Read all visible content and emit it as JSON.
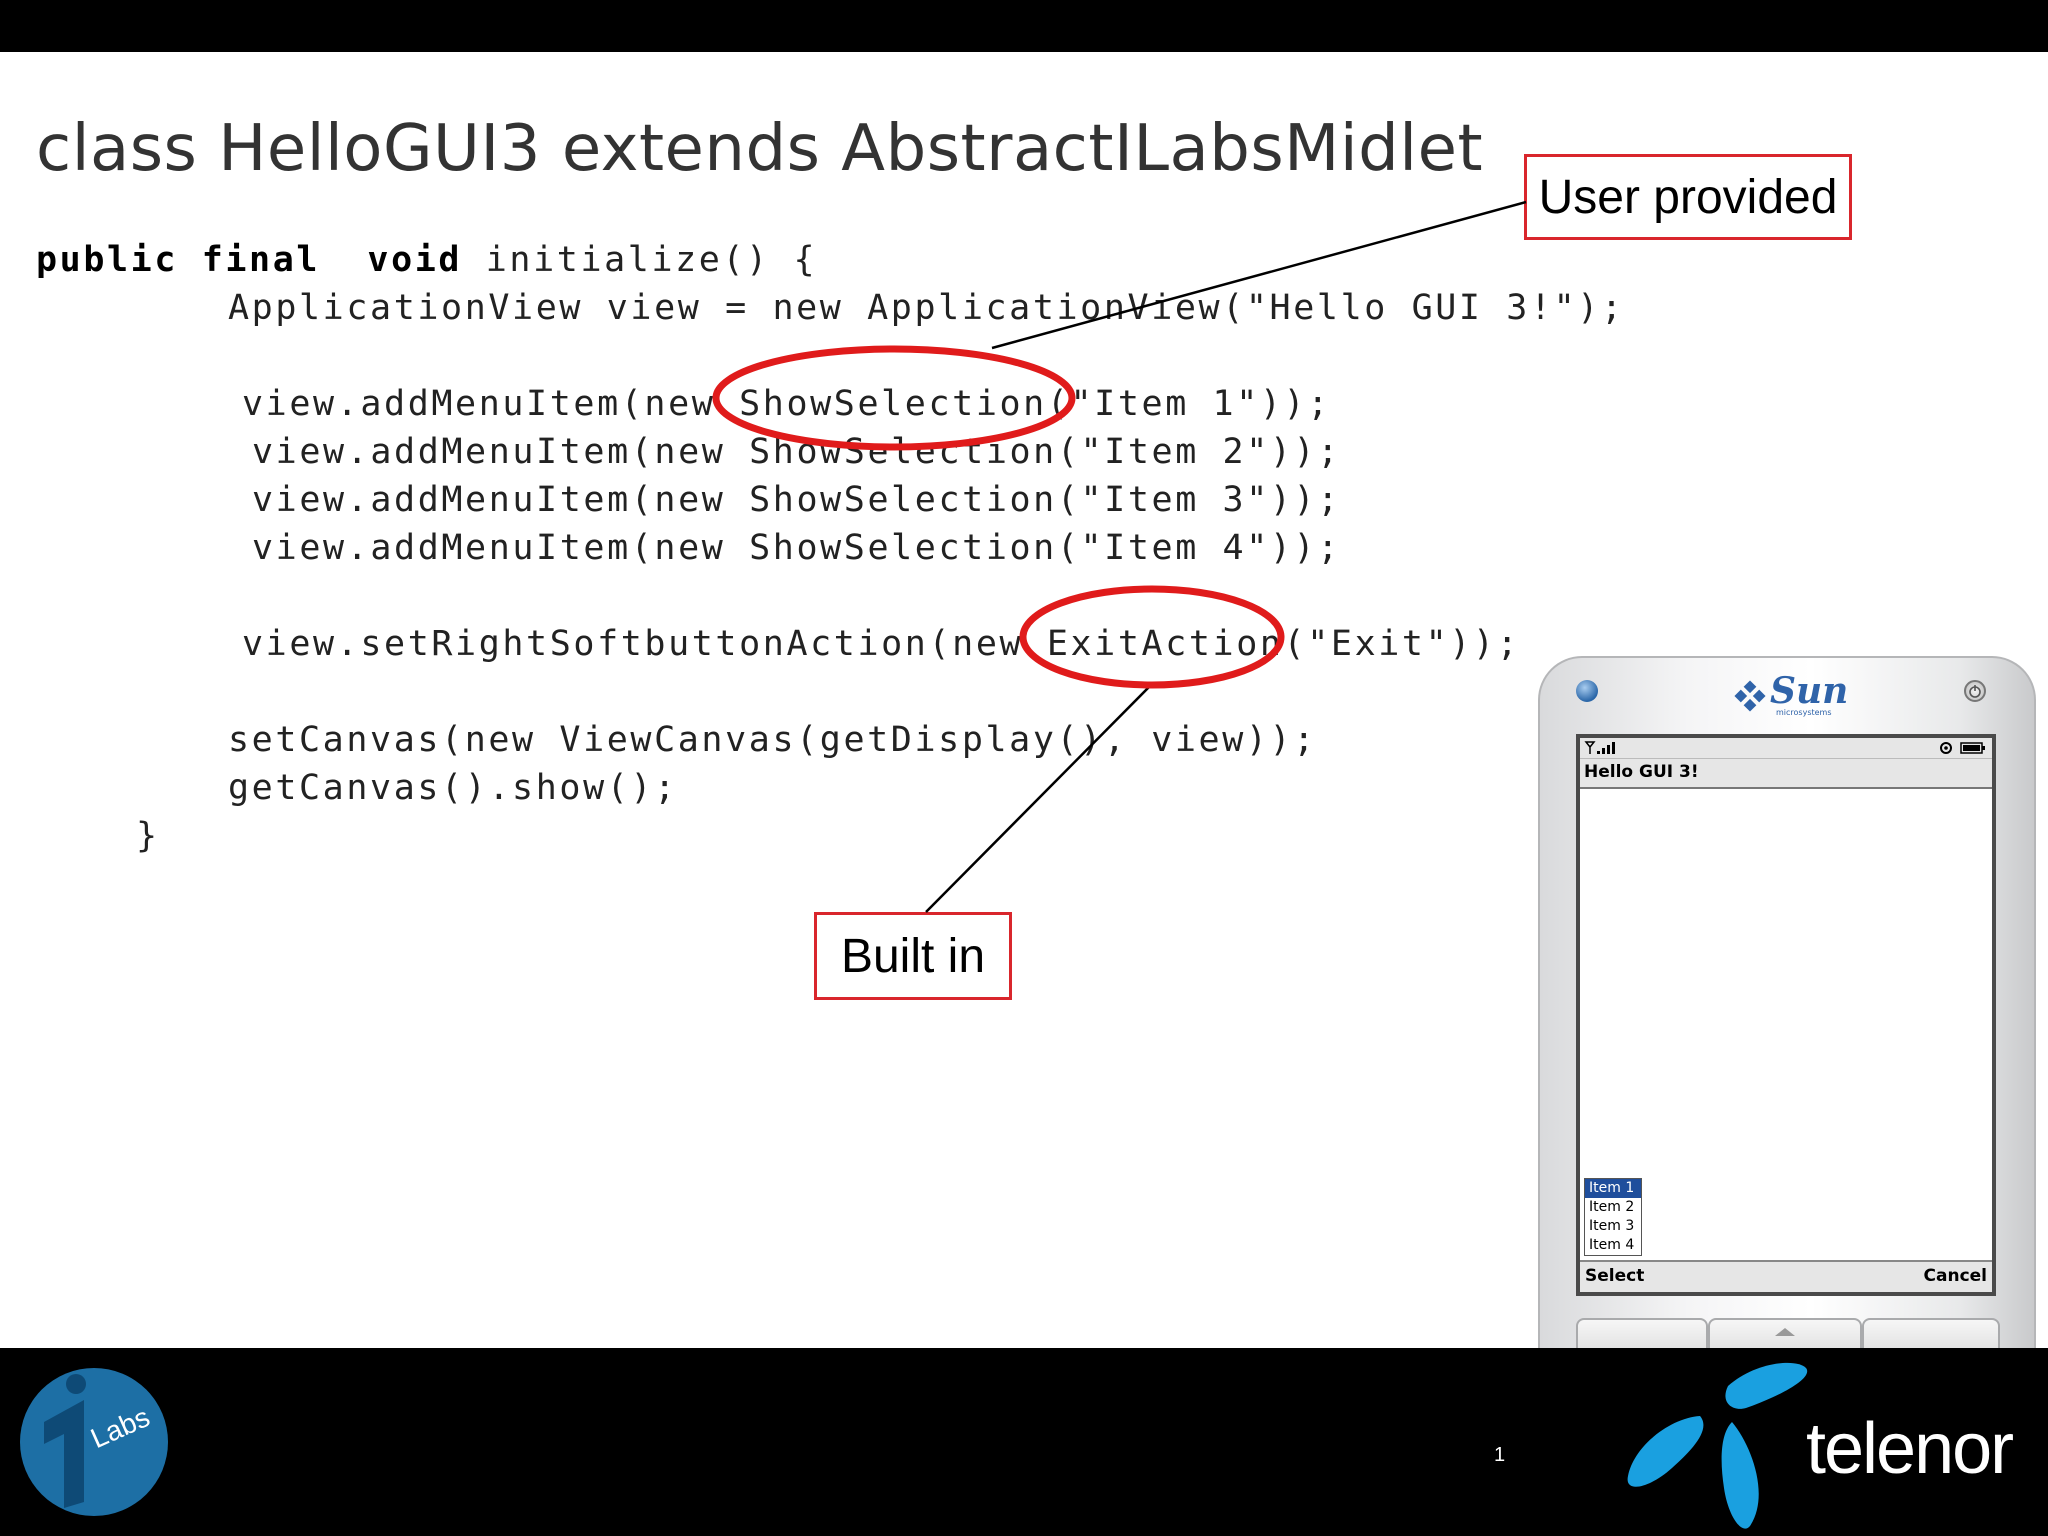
{
  "slide": {
    "title": "class HelloGUI3 extends AbstractILabsMidlet",
    "page_number": "1"
  },
  "code": {
    "line1_kw1": "public",
    "line1_kw2": "final",
    "line1_kw3": "void",
    "line1_rest": "initialize() {",
    "line2": "ApplicationView view = new ApplicationView(\"Hello GUI 3!\");",
    "line3": "view.addMenuItem(new ShowSelection(\"Item 1\"));",
    "line4": "view.addMenuItem(new ShowSelection(\"Item 2\"));",
    "line5": "view.addMenuItem(new ShowSelection(\"Item 3\"));",
    "line6": "view.addMenuItem(new ShowSelection(\"Item 4\"));",
    "line7": "view.setRightSoftbuttonAction(new ExitAction(\"Exit\"));",
    "line8": "setCanvas(new ViewCanvas(getDisplay(), view));",
    "line9": "getCanvas().show();",
    "line10": "}"
  },
  "callouts": {
    "user_provided": "User provided",
    "built_in": "Built in"
  },
  "phone": {
    "brand": "Sun",
    "brand_sub": "microsystems",
    "app_title": "Hello GUI 3!",
    "menu_items": [
      "Item 1",
      "Item 2",
      "Item 3",
      "Item 4"
    ],
    "left_soft": "Select",
    "right_soft": "Cancel"
  },
  "logos": {
    "ilabs": "Labs",
    "telenor": "telenor"
  },
  "colors": {
    "callout_border": "#d9262c",
    "highlight_ellipse": "#e01b1b",
    "telenor_blue": "#1aa0e0",
    "ilabs_blue": "#1d6fa5",
    "menu_selected": "#1f4e9c"
  }
}
